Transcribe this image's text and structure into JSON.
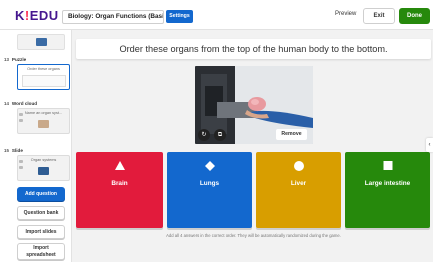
{
  "app": {
    "logo_k": "K",
    "logo_bang": "!",
    "logo_rest": "EDU",
    "title": "Biology: Organ Functions (Basic)",
    "settings_label": "Settings",
    "preview_label": "Preview",
    "exit_label": "Exit",
    "done_label": "Done"
  },
  "sidebar": {
    "items": [
      {
        "num": "13",
        "type": "Puzzle",
        "preview_text": "Order these organs",
        "active": true
      },
      {
        "num": "14",
        "type": "Word cloud",
        "preview_text": "Name an organ syst...",
        "active": false
      },
      {
        "num": "15",
        "type": "Slide",
        "preview_text": "Organ systems",
        "active": false
      }
    ],
    "buttons": {
      "add_question": "Add question",
      "question_bank": "Question bank",
      "import_slides": "Import slides",
      "import_spreadsheet_line1": "Import",
      "import_spreadsheet_line2": "spreadsheet"
    }
  },
  "question": {
    "text": "Order these organs from the top of the human body to the bottom."
  },
  "media": {
    "remove_label": "Remove",
    "rotate_icon": "rotate-icon",
    "crop_icon": "crop-icon"
  },
  "answers": [
    {
      "label": "Brain",
      "shape": "triangle",
      "color": "#e21b3c"
    },
    {
      "label": "Lungs",
      "shape": "diamond",
      "color": "#1368ce"
    },
    {
      "label": "Liver",
      "shape": "circle",
      "color": "#d89e00"
    },
    {
      "label": "Large intestine",
      "shape": "square",
      "color": "#26890c"
    }
  ],
  "hint": "Add all 4 answers in the correct order. They will be automatically randomized during the game.",
  "collapse_glyph": "‹"
}
